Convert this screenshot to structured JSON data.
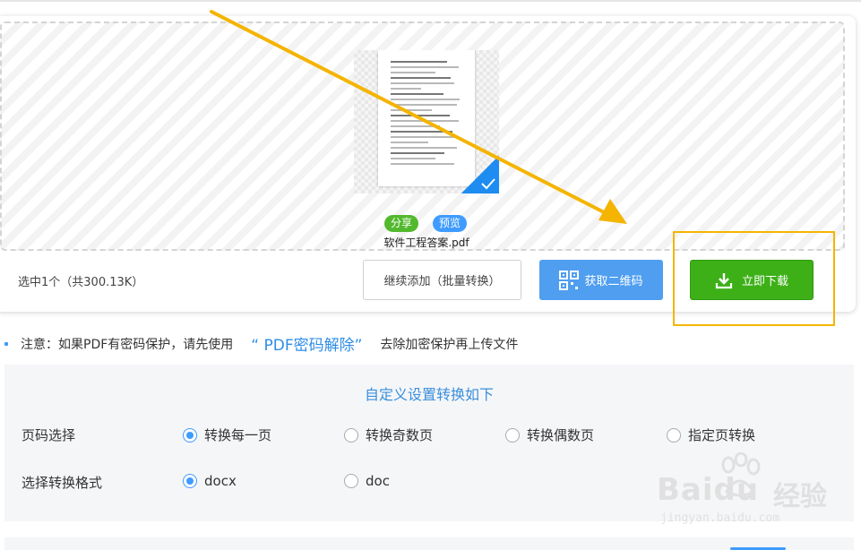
{
  "file": {
    "name": "软件工程答案.pdf",
    "share_label": "分享",
    "preview_label": "预览"
  },
  "toolbar": {
    "selected_info": "选中1个（共300.13K）",
    "continue_label": "继续添加（批量转换）",
    "qr_label": "获取二维码",
    "download_label": "立即下载"
  },
  "notice": {
    "prefix": "注意：如果PDF有密码保护，请先使用",
    "link": "“ PDF密码解除”",
    "suffix": "去除加密保护再上传文件"
  },
  "settings": {
    "title": "自定义设置转换如下",
    "page_label": "页码选择",
    "page_options": [
      "转换每一页",
      "转换奇数页",
      "转换偶数页",
      "指定页转换"
    ],
    "page_selected": 0,
    "format_label": "选择转换格式",
    "format_options": [
      "docx",
      "doc"
    ],
    "format_selected": 0
  },
  "watermark": {
    "brand": "Baidu",
    "brand_cn": "经验",
    "url": "jingyan.baidu.com"
  },
  "colors": {
    "accent_blue": "#3e9bff",
    "download_green": "#3db018",
    "highlight_yellow": "#f4b400"
  }
}
